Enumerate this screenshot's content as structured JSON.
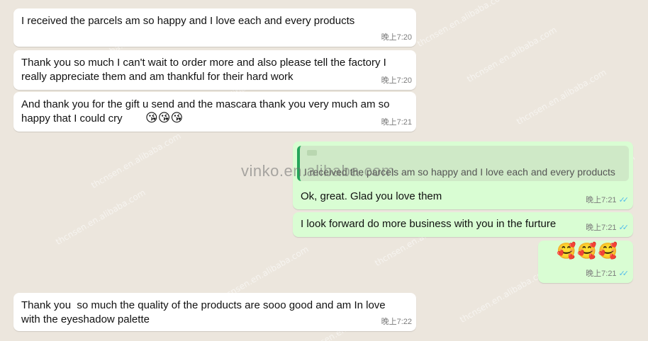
{
  "watermark": {
    "center": "vinko.en.alibaba.com",
    "repeat": "thcnsen.en.alibaba.com"
  },
  "messages": [
    {
      "text": "I received the parcels am so happy and I love each and every products",
      "time": "晚上7:20"
    },
    {
      "text": "Thank you so much I can't wait to order more and also please tell the factory I\nreally appreciate them and am thankful for their hard work",
      "time": "晚上7:20"
    },
    {
      "text": "And thank you for the gift u send and the mascara thank you very much am so\nhappy that I could cry",
      "emoji": "😘😘😘",
      "time": "晚上7:21"
    },
    {
      "quote_text": "I received the parcels am so happy and I love each and every products",
      "text": "Ok, great. Glad you love them",
      "time": "晚上7:21"
    },
    {
      "text": "I look forward do more business with you in the furture",
      "time": "晚上7:21"
    },
    {
      "emoji": "🥰🥰🥰",
      "time": "晚上7:21"
    },
    {
      "text": "Thank you  so much the quality of the products are sooo good and am In love\nwith the eyeshadow palette",
      "time": "晚上7:22"
    }
  ],
  "colors": {
    "incoming": "#ffffff",
    "outgoing": "#d9fdd3",
    "read_ticks": "#53bdeb",
    "quote_bar": "#25a55b"
  },
  "icons": {
    "read_receipt": "double-check-icon"
  }
}
